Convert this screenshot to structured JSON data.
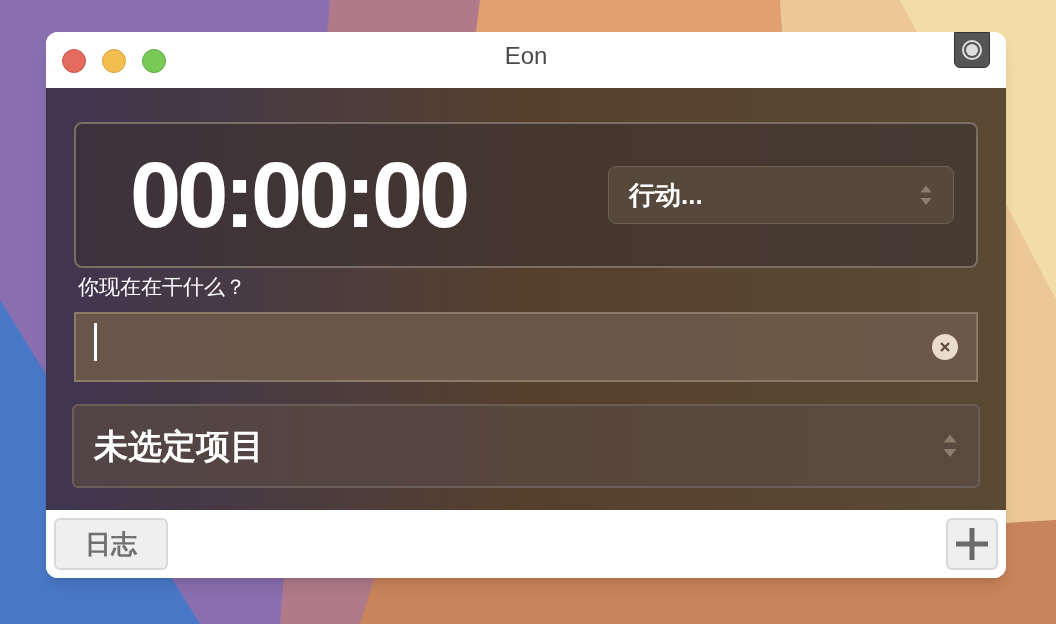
{
  "window": {
    "title": "Eon"
  },
  "timer": {
    "display": "00:00:00"
  },
  "action_select": {
    "value": "行动..."
  },
  "prompt": {
    "label": "你现在在干什么？"
  },
  "activity_field": {
    "focused": true
  },
  "project_select": {
    "value": "未选定项目"
  },
  "footer": {
    "log_button": "日志"
  }
}
